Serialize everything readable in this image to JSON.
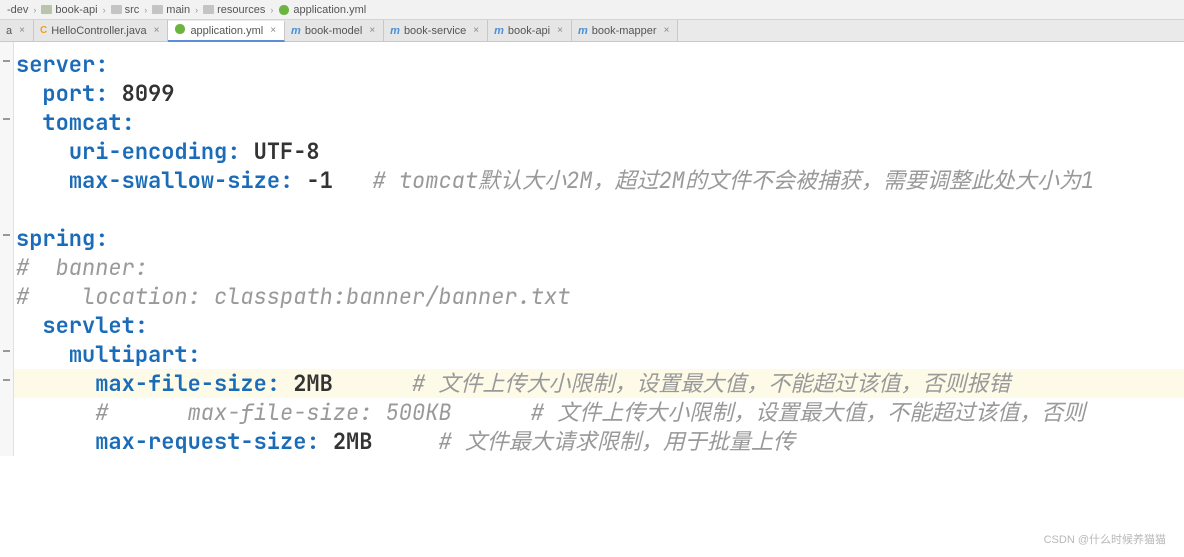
{
  "breadcrumb": {
    "items": [
      {
        "label": "-dev"
      },
      {
        "label": "book-api"
      },
      {
        "label": "src"
      },
      {
        "label": "main"
      },
      {
        "label": "resources"
      },
      {
        "label": "application.yml"
      }
    ]
  },
  "tabs": [
    {
      "label": "a",
      "icon": "none",
      "active": false,
      "closable": true
    },
    {
      "label": "HelloController.java",
      "icon": "java",
      "active": false,
      "closable": true
    },
    {
      "label": "application.yml",
      "icon": "yml",
      "active": true,
      "closable": true
    },
    {
      "label": "book-model",
      "icon": "module",
      "active": false,
      "closable": true
    },
    {
      "label": "book-service",
      "icon": "module",
      "active": false,
      "closable": true
    },
    {
      "label": "book-api",
      "icon": "module",
      "active": false,
      "closable": true
    },
    {
      "label": "book-mapper",
      "icon": "module",
      "active": false,
      "closable": true
    }
  ],
  "code": {
    "l1_key": "server",
    "l2_key": "port",
    "l2_val": "8099",
    "l3_key": "tomcat",
    "l4_key": "uri-encoding",
    "l4_val": "UTF-8",
    "l5_key": "max-swallow-size",
    "l5_val": "-1",
    "l5_comment": "# tomcat默认大小2M，超过2M的文件不会被捕获，需要调整此处大小为1",
    "l7_key": "spring",
    "l8_comment": "#  banner:",
    "l9_comment": "#    location: classpath:banner/banner.txt",
    "l10_key": "servlet",
    "l11_key": "multipart",
    "l12_key": "max-file-size",
    "l12_val": "2MB",
    "l12_comment": "# 文件上传大小限制，设置最大值，不能超过该值，否则报错",
    "l13_comment": "#      max-file-size: 500KB      # 文件上传大小限制，设置最大值，不能超过该值，否则",
    "l14_key": "max-request-size",
    "l14_val": "2MB",
    "l14_comment": "# 文件最大请求限制，用于批量上传"
  },
  "watermark": "CSDN @什么时候养猫猫"
}
